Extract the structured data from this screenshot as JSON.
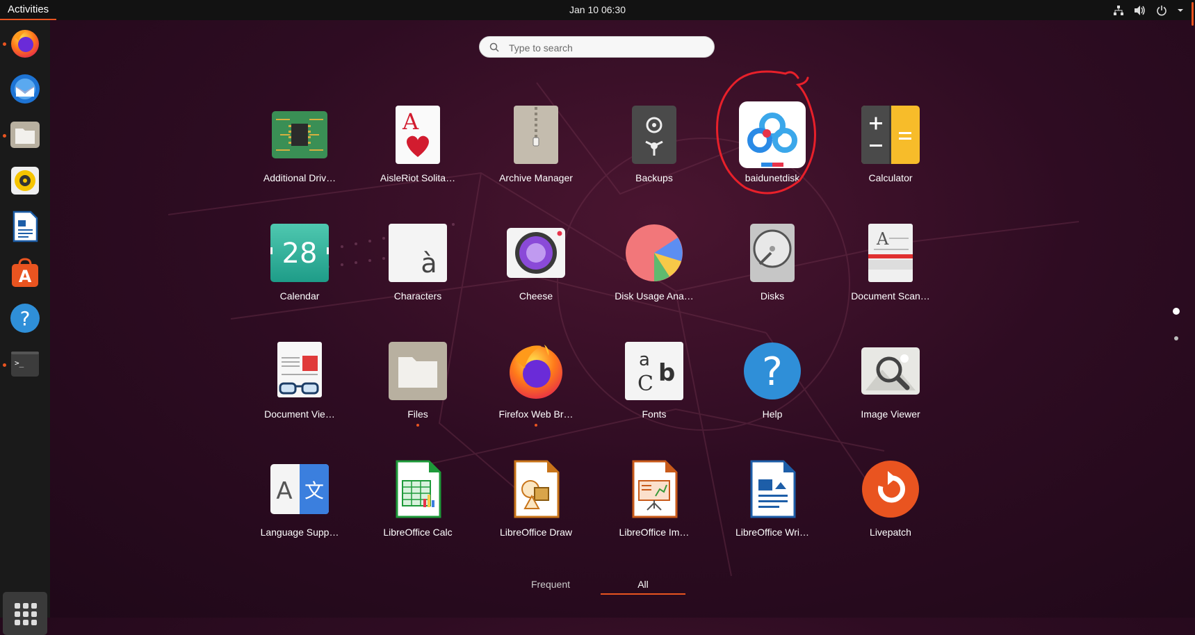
{
  "topbar": {
    "activities": "Activities",
    "clock": "Jan 10  06:30",
    "tray_icons": [
      "network-icon",
      "volume-icon",
      "power-icon",
      "chevron-down-icon"
    ]
  },
  "dock": {
    "items": [
      {
        "name": "firefox",
        "icon": "firefox-icon",
        "running": true
      },
      {
        "name": "thunderbird",
        "icon": "thunderbird-icon",
        "running": false
      },
      {
        "name": "files",
        "icon": "files-icon",
        "running": true
      },
      {
        "name": "rhythmbox",
        "icon": "rhythmbox-icon",
        "running": false
      },
      {
        "name": "libreoffice-writer",
        "icon": "writer-icon",
        "running": false
      },
      {
        "name": "ubuntu-software",
        "icon": "software-icon",
        "running": false
      },
      {
        "name": "help",
        "icon": "help-icon",
        "running": false
      },
      {
        "name": "terminal",
        "icon": "terminal-icon",
        "running": true
      }
    ],
    "show_apps": "show-applications-icon"
  },
  "search": {
    "placeholder": "Type to search",
    "value": ""
  },
  "apps": [
    {
      "label": "Additional Driv…",
      "icon": "chip-icon"
    },
    {
      "label": "AisleRiot Solita…",
      "icon": "cards-icon"
    },
    {
      "label": "Archive Manager",
      "icon": "archive-icon"
    },
    {
      "label": "Backups",
      "icon": "safe-icon"
    },
    {
      "label": "baidunetdisk",
      "icon": "baidunetdisk-icon"
    },
    {
      "label": "Calculator",
      "icon": "calculator-icon"
    },
    {
      "label": "Calendar",
      "icon": "calendar-icon",
      "text": "28"
    },
    {
      "label": "Characters",
      "icon": "characters-icon",
      "text": "à"
    },
    {
      "label": "Cheese",
      "icon": "camera-icon"
    },
    {
      "label": "Disk Usage Ana…",
      "icon": "pie-icon"
    },
    {
      "label": "Disks",
      "icon": "disk-icon"
    },
    {
      "label": "Document Scan…",
      "icon": "scanner-icon",
      "text": "A"
    },
    {
      "label": "Document Vie…",
      "icon": "document-viewer-icon"
    },
    {
      "label": "Files",
      "icon": "files-icon",
      "running": true
    },
    {
      "label": "Firefox Web Br…",
      "icon": "firefox-icon",
      "running": true
    },
    {
      "label": "Fonts",
      "icon": "fonts-icon"
    },
    {
      "label": "Help",
      "icon": "help-icon",
      "text": "?"
    },
    {
      "label": "Image Viewer",
      "icon": "image-viewer-icon"
    },
    {
      "label": "Language Supp…",
      "icon": "language-icon",
      "text": "A",
      "text2": "文"
    },
    {
      "label": "LibreOffice Calc",
      "icon": "calc-icon"
    },
    {
      "label": "LibreOffice Draw",
      "icon": "draw-icon"
    },
    {
      "label": "LibreOffice Im…",
      "icon": "impress-icon"
    },
    {
      "label": "LibreOffice Wri…",
      "icon": "writer-icon"
    },
    {
      "label": "Livepatch",
      "icon": "livepatch-icon"
    }
  ],
  "pages": {
    "count": 2,
    "current": 1
  },
  "tabs": [
    {
      "label": "Frequent",
      "active": false
    },
    {
      "label": "All",
      "active": true
    }
  ],
  "colors": {
    "accent": "#e95420",
    "annotation": "#e8202a"
  }
}
